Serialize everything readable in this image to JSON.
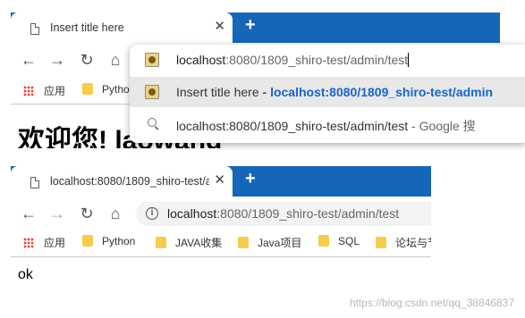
{
  "browser_top": {
    "tab": {
      "title": "Insert title here"
    },
    "bookmarks": {
      "apps": "应用",
      "items": [
        "Python"
      ]
    },
    "omnibox_dropdown": {
      "typed_host": "localhost",
      "typed_rest": ":8080/1809_shiro-test/admin/test",
      "suggestion_title": "Insert title here",
      "suggestion_sep": " - ",
      "suggestion_url": "localhost:8080/1809_shiro-test/admin",
      "search_query": "localhost:8080/1809_shiro-test/admin/test",
      "search_suffix": " - Google 搜"
    },
    "page_heading": "欢迎您! laowang"
  },
  "browser_bottom": {
    "tab": {
      "title": "localhost:8080/1809_shiro-test/a"
    },
    "address": {
      "host": "localhost",
      "path": ":8080/1809_shiro-test/admin/test"
    },
    "bookmarks": {
      "apps": "应用",
      "items": [
        "Python",
        "JAVA收集",
        "Java项目",
        "SQL",
        "论坛与节"
      ]
    },
    "page_text": "ok"
  },
  "watermark": "https://blog.csdn.net/qq_38846837",
  "colors": {
    "tab_strip": "#1566b8",
    "link": "#1a64c8",
    "folder": "#f7cb4d"
  }
}
